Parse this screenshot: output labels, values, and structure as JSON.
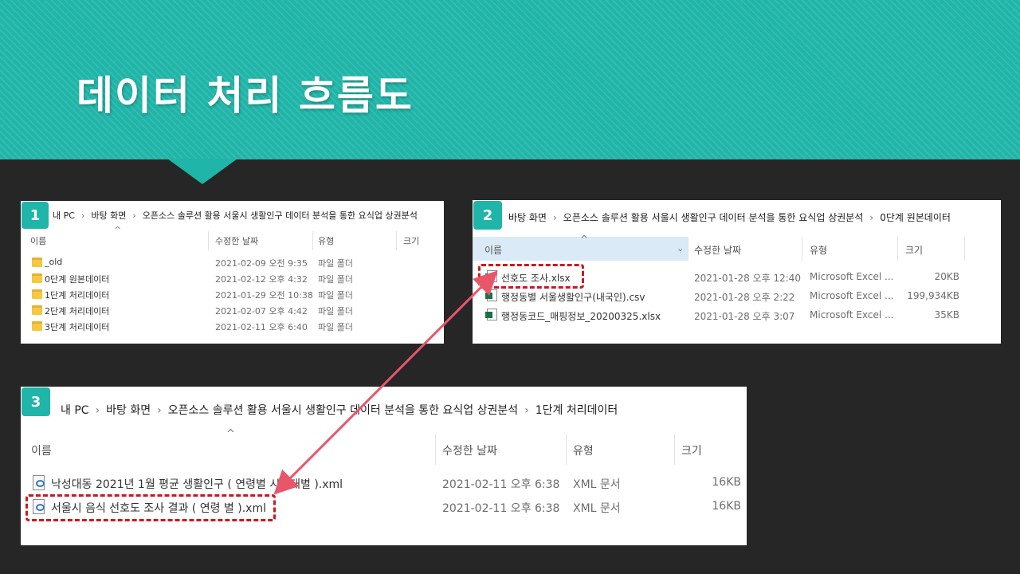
{
  "title": "데이터 처리 흐름도",
  "panel1": {
    "badge": "1",
    "breadcrumb": [
      "내 PC",
      "바탕 화면",
      "오픈소스 솔루션 활용 서울시 생활인구 데이터 분석을 통한 요식업 상권분석"
    ],
    "columns": {
      "name": "이름",
      "date": "수정한 날짜",
      "type": "유형",
      "size": "크기"
    },
    "rows": [
      {
        "name": "_old",
        "date": "2021-02-09 오전 9:35",
        "type": "파일 폴더"
      },
      {
        "name": "0단계 원본데이터",
        "date": "2021-02-12 오후 4:32",
        "type": "파일 폴더"
      },
      {
        "name": "1단계 처리데이터",
        "date": "2021-01-29 오전 10:38",
        "type": "파일 폴더"
      },
      {
        "name": "2단계 처리데이터",
        "date": "2021-02-07 오후 4:42",
        "type": "파일 폴더"
      },
      {
        "name": "3단계 처리데이터",
        "date": "2021-02-11 오후 6:40",
        "type": "파일 폴더"
      }
    ]
  },
  "panel2": {
    "badge": "2",
    "breadcrumb": [
      "바탕 화면",
      "오픈소스 솔루션 활용 서울시 생활인구 데이터 분석을 통한 요식업 상권분석",
      "0단계 원본데이터"
    ],
    "columns": {
      "name": "이름",
      "date": "수정한 날짜",
      "type": "유형",
      "size": "크기"
    },
    "rows": [
      {
        "name": "선호도 조사.xlsx",
        "date": "2021-01-28 오후 12:40",
        "type": "Microsoft Excel ...",
        "size": "20KB"
      },
      {
        "name": "행정동별 서울생활인구(내국인).csv",
        "date": "2021-01-28 오후 2:22",
        "type": "Microsoft Excel ...",
        "size": "199,934KB"
      },
      {
        "name": "행정동코드_매핑정보_20200325.xlsx",
        "date": "2021-01-28 오후 3:07",
        "type": "Microsoft Excel ...",
        "size": "35KB"
      }
    ]
  },
  "panel3": {
    "badge": "3",
    "breadcrumb": [
      "내 PC",
      "바탕 화면",
      "오픈소스 솔루션 활용 서울시 생활인구 데이터 분석을 통한 요식업 상권분석",
      "1단계 처리데이터"
    ],
    "columns": {
      "name": "이름",
      "date": "수정한 날짜",
      "type": "유형",
      "size": "크기"
    },
    "rows": [
      {
        "name": "낙성대동 2021년 1월 평균 생활인구 ( 연령별 시간대별 ).xml",
        "date": "2021-02-11 오후 6:38",
        "type": "XML 문서",
        "size": "16KB"
      },
      {
        "name": "서울시 음식 선호도 조사 결과 ( 연령 별 ).xml",
        "date": "2021-02-11 오후 6:38",
        "type": "XML 문서",
        "size": "16KB"
      }
    ]
  },
  "colors": {
    "accent": "#1fb5a8",
    "highlight": "#d0161c",
    "arrow": "#e8566a",
    "background": "#262626"
  },
  "icons": {
    "folder": "folder-icon",
    "excel": "excel-file-icon",
    "xml": "xml-file-icon",
    "chevron": "chevron-right-icon",
    "sort": "sort-up-icon"
  }
}
